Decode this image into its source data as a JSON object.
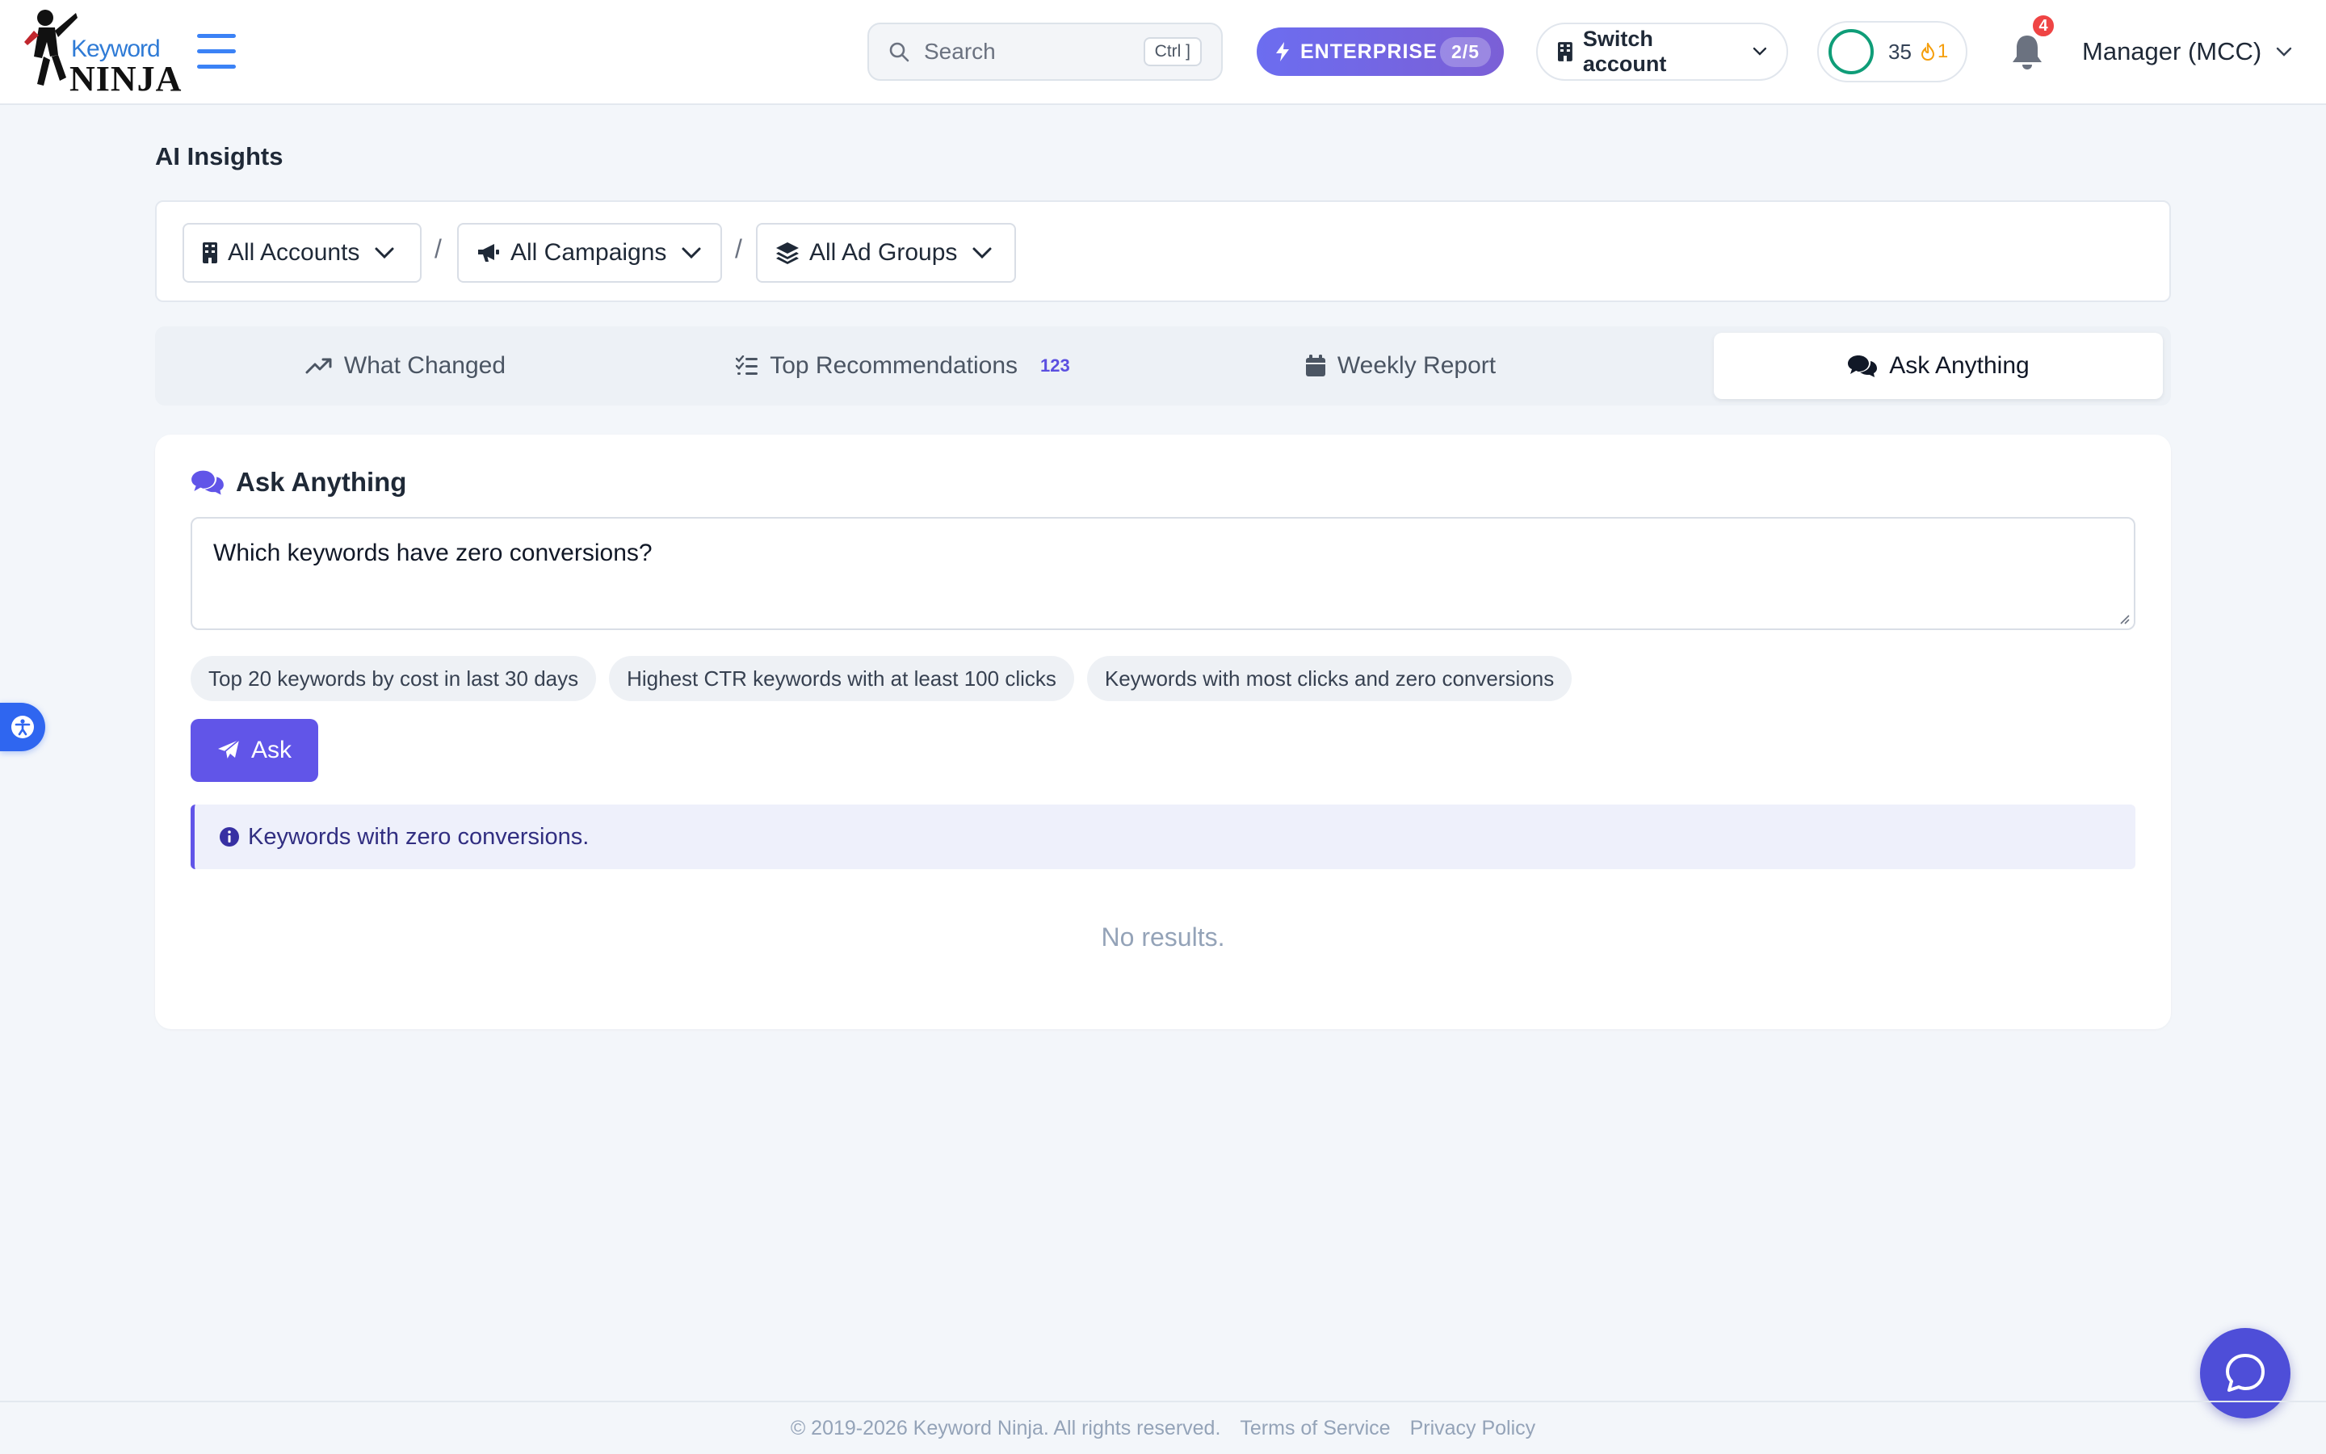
{
  "header": {
    "logo_word": "Keyword",
    "logo_ninja": "NINJA",
    "search_placeholder": "Search",
    "search_shortcut": "Ctrl ]",
    "plan_label": "ENTERPRISE",
    "plan_usage": "2/5",
    "switch_account_label": "Switch account",
    "score_value": "35",
    "streak_value": "1",
    "notifications_count": "4",
    "account_label": "Manager (MCC)"
  },
  "page": {
    "title": "AI Insights"
  },
  "filters": {
    "accounts": "All Accounts",
    "campaigns": "All Campaigns",
    "ad_groups": "All Ad Groups",
    "separator": "/"
  },
  "tabs": [
    {
      "label": "What Changed",
      "icon": "trending-up-icon"
    },
    {
      "label": "Top Recommendations",
      "icon": "list-check-icon",
      "count": "123"
    },
    {
      "label": "Weekly Report",
      "icon": "calendar-icon"
    },
    {
      "label": "Ask Anything",
      "icon": "comments-icon",
      "active": true
    }
  ],
  "ask": {
    "title": "Ask Anything",
    "question": "Which keywords have zero conversions?",
    "suggestions": [
      "Top 20 keywords by cost in last 30 days",
      "Highest CTR keywords with at least 100 clicks",
      "Keywords with most clicks and zero conversions"
    ],
    "ask_button": "Ask",
    "info_message": "Keywords with zero conversions.",
    "empty_message": "No results."
  },
  "footer": {
    "copyright": "© 2019-2026 Keyword Ninja. All rights reserved.",
    "terms": "Terms of Service",
    "privacy": "Privacy Policy"
  },
  "colors": {
    "accent": "#6155e8",
    "background": "#f3f6fa",
    "notification": "#ef4444",
    "fab": "#4e4ed8"
  }
}
